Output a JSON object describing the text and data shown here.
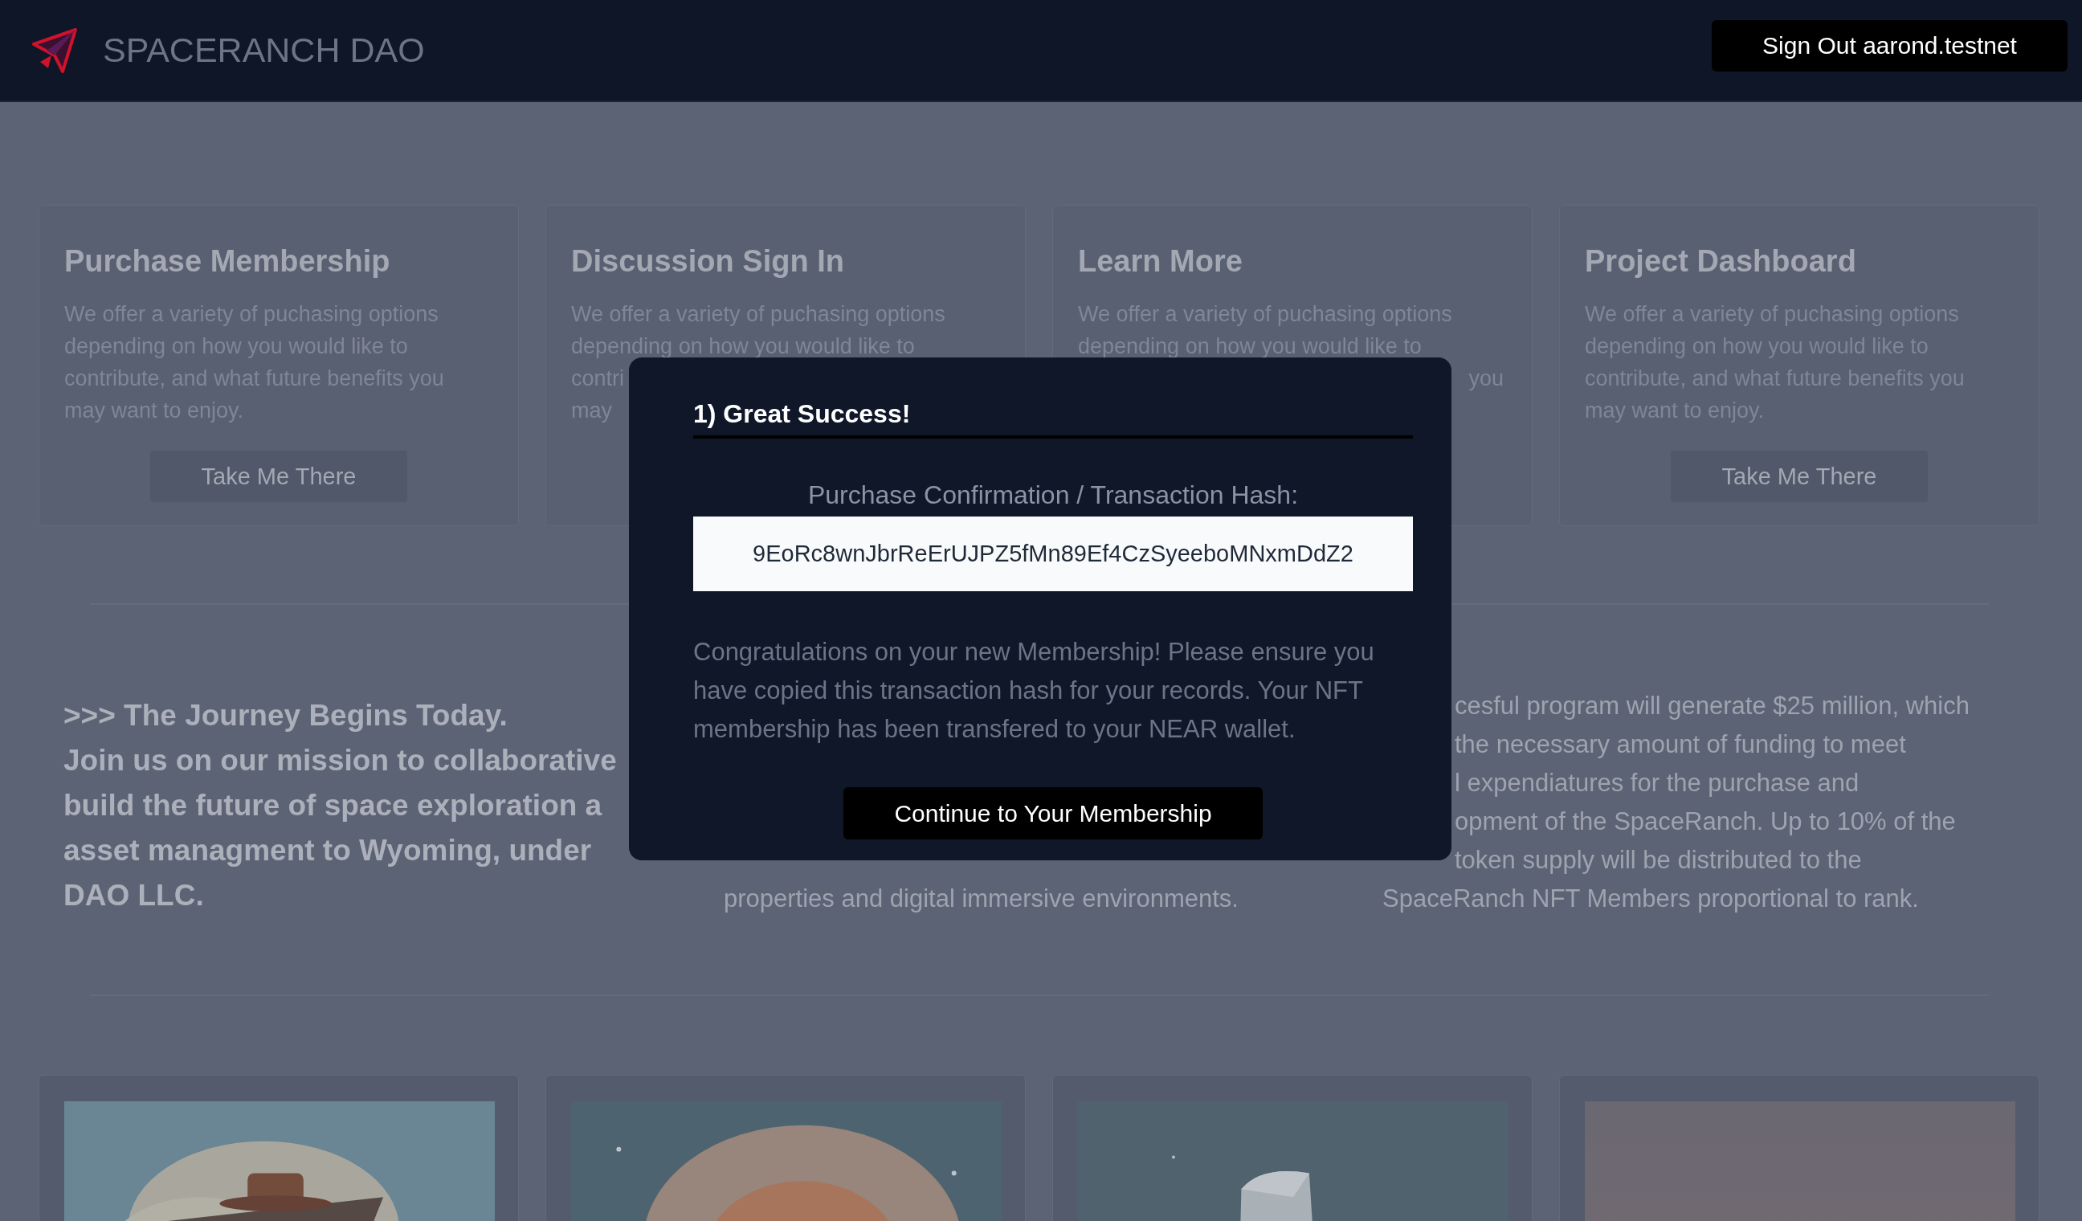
{
  "header": {
    "title": "SPACERANCH DAO",
    "sign_out_button": "Sign Out aarond.testnet"
  },
  "cards": [
    {
      "title": "Purchase Membership",
      "lines": [
        "We offer a variety of puchasing options",
        "depending on how you would like to",
        "contribute, and what future benefits you",
        "may want to enjoy."
      ],
      "button": "Take Me There"
    },
    {
      "title": "Discussion Sign In",
      "lines": [
        "We offer a variety of puchasing options",
        "depending on how you would like to",
        "contri",
        "may"
      ]
    },
    {
      "title": "Learn More",
      "lines": [
        "We offer a variety of puchasing options",
        "depending on how you would like to"
      ],
      "tail": "you"
    },
    {
      "title": "Project Dashboard",
      "lines": [
        "We offer a variety of puchasing options",
        "depending on how you would like to",
        "contribute, and what future benefits you",
        "may want to enjoy."
      ],
      "button": "Take Me There"
    }
  ],
  "intro": {
    "heading_lines": [
      ">>> The Journey Begins Today.",
      "Join us on our mission to collaborative",
      "build the future of space exploration a",
      "asset managment to Wyoming, under",
      "DAO LLC."
    ],
    "columns": [
      {
        "lines": [
          {
            "text": "properties and digital immersive environments.",
            "kind": "full"
          }
        ]
      },
      {
        "lines": [
          {
            "text": "cesful program will generate $25 million, which",
            "kind": "after"
          },
          {
            "text": "the necessary amount of funding to meet",
            "kind": "after"
          },
          {
            "text": "l expendiatures for the purchase and",
            "kind": "after"
          },
          {
            "text": "opment of the SpaceRanch. Up to 10% of the",
            "kind": "after"
          },
          {
            "text": "token supply will be distributed to the",
            "kind": "after"
          },
          {
            "text": "SpaceRanch NFT Members proportional to rank.",
            "kind": "full"
          }
        ]
      }
    ]
  },
  "modal": {
    "title": "1) Great Success!",
    "hash_label": "Purchase Confirmation / Transaction Hash:",
    "hash": "9EoRc8wnJbrReErUJPZ5fMn89Ef4CzSyeeboMNxmDdZ2",
    "message": "Congratulations on your new Membership! Please ensure you have copied this transaction hash for your records. Your NFT membership has been transfered to your NEAR wallet.",
    "button": "Continue to Your Membership"
  }
}
